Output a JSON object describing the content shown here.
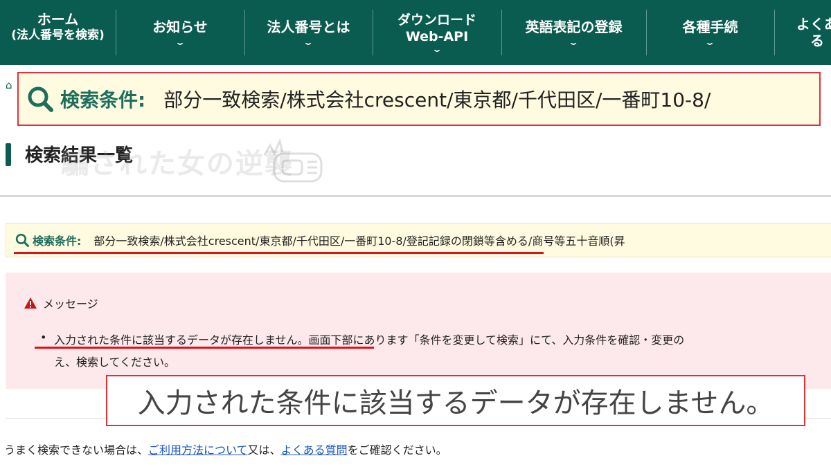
{
  "nav": {
    "items": [
      {
        "line1": "ホーム",
        "line2": "(法人番号を検索)",
        "chevron": ""
      },
      {
        "line1": "お知らせ",
        "line2": "",
        "chevron": "⌄"
      },
      {
        "line1": "法人番号とは",
        "line2": "",
        "chevron": "⌄"
      },
      {
        "line1": "ダウンロード",
        "line2": "Web-API",
        "chevron": "⌄"
      },
      {
        "line1": "英語表記の登録",
        "line2": "",
        "chevron": "⌄"
      },
      {
        "line1": "各種手続",
        "line2": "",
        "chevron": "⌄"
      },
      {
        "line1": "よくある",
        "line2": "",
        "chevron": ""
      }
    ]
  },
  "zoom_condition": {
    "label": "検索条件:",
    "value": "部分一致検索/株式会社crescent/東京都/千代田区/一番町10-8/"
  },
  "heading": "検索結果一覧",
  "watermark": "騙された女の逆襲",
  "condition": {
    "label": "検索条件:",
    "value": "部分一致検索/株式会社crescent/東京都/千代田区/一番町10-8/登記記録の閉鎖等含める/商号等五十音順(昇"
  },
  "message": {
    "title": "メッセージ",
    "bullet": "•",
    "line1": "入力された条件に該当するデータが存在しません。画面下部にあります「条件を変更して検索」にて、入力条件を確認・変更の",
    "line2": "え、検索してください。"
  },
  "zoom_message": "入力された条件に該当するデータが存在しません。",
  "footer": {
    "prefix": "うまく検索できない場合は、",
    "link1": "ご利用方法について",
    "middle": "又は、",
    "link2": "よくある質問",
    "suffix": "をご確認ください。"
  },
  "colors": {
    "nav_bg": "#0b5c50",
    "accent_green": "#1e6e5e",
    "highlight_red": "#e0303a",
    "condition_bg": "#fffbe0",
    "message_bg": "#fde9ec",
    "link": "#1a55c4"
  },
  "icons": {
    "home": "home-icon",
    "search": "magnifier-icon",
    "warning": "warning-icon"
  }
}
